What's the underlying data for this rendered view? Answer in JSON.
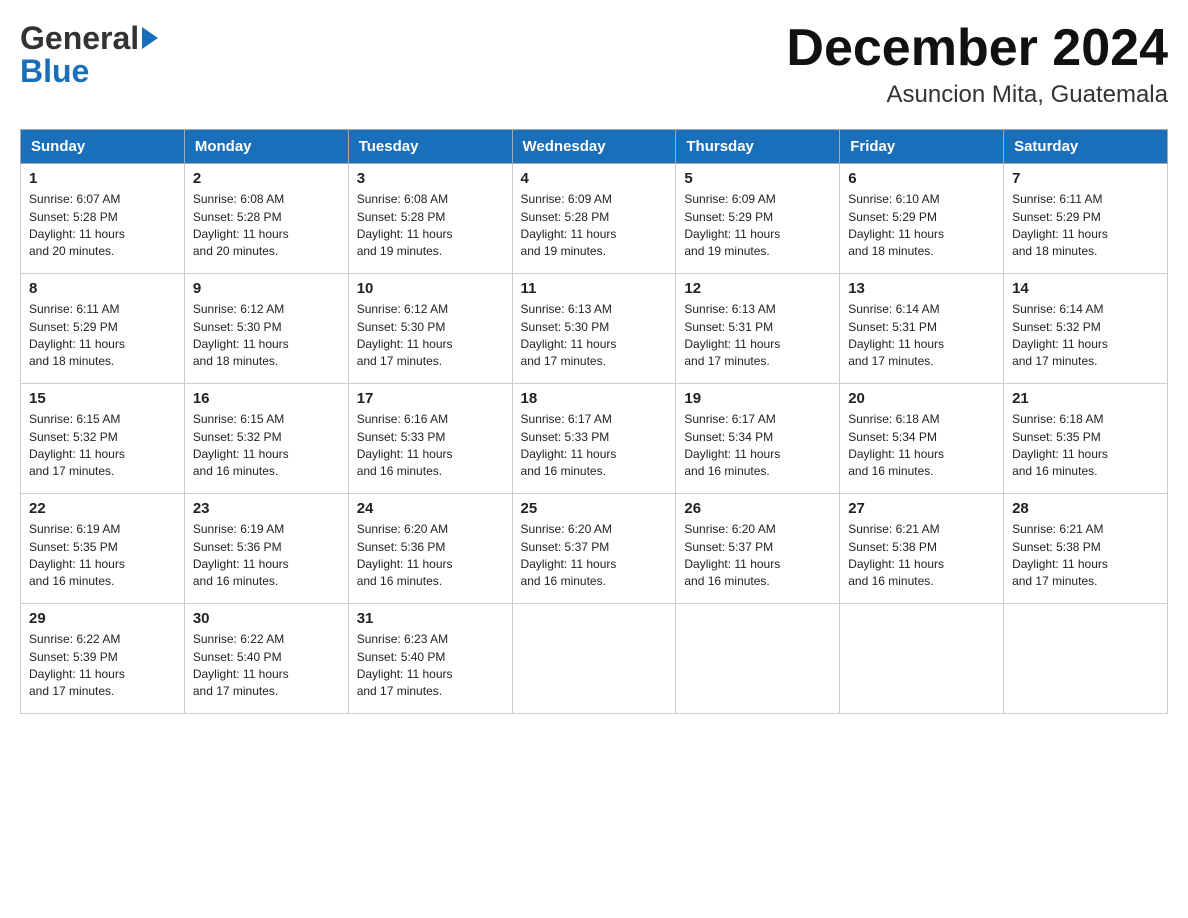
{
  "header": {
    "logo_general": "General",
    "logo_blue": "Blue",
    "month_title": "December 2024",
    "location": "Asuncion Mita, Guatemala"
  },
  "weekdays": [
    "Sunday",
    "Monday",
    "Tuesday",
    "Wednesday",
    "Thursday",
    "Friday",
    "Saturday"
  ],
  "weeks": [
    [
      {
        "day": "1",
        "sunrise": "6:07 AM",
        "sunset": "5:28 PM",
        "daylight": "11 hours and 20 minutes."
      },
      {
        "day": "2",
        "sunrise": "6:08 AM",
        "sunset": "5:28 PM",
        "daylight": "11 hours and 20 minutes."
      },
      {
        "day": "3",
        "sunrise": "6:08 AM",
        "sunset": "5:28 PM",
        "daylight": "11 hours and 19 minutes."
      },
      {
        "day": "4",
        "sunrise": "6:09 AM",
        "sunset": "5:28 PM",
        "daylight": "11 hours and 19 minutes."
      },
      {
        "day": "5",
        "sunrise": "6:09 AM",
        "sunset": "5:29 PM",
        "daylight": "11 hours and 19 minutes."
      },
      {
        "day": "6",
        "sunrise": "6:10 AM",
        "sunset": "5:29 PM",
        "daylight": "11 hours and 18 minutes."
      },
      {
        "day": "7",
        "sunrise": "6:11 AM",
        "sunset": "5:29 PM",
        "daylight": "11 hours and 18 minutes."
      }
    ],
    [
      {
        "day": "8",
        "sunrise": "6:11 AM",
        "sunset": "5:29 PM",
        "daylight": "11 hours and 18 minutes."
      },
      {
        "day": "9",
        "sunrise": "6:12 AM",
        "sunset": "5:30 PM",
        "daylight": "11 hours and 18 minutes."
      },
      {
        "day": "10",
        "sunrise": "6:12 AM",
        "sunset": "5:30 PM",
        "daylight": "11 hours and 17 minutes."
      },
      {
        "day": "11",
        "sunrise": "6:13 AM",
        "sunset": "5:30 PM",
        "daylight": "11 hours and 17 minutes."
      },
      {
        "day": "12",
        "sunrise": "6:13 AM",
        "sunset": "5:31 PM",
        "daylight": "11 hours and 17 minutes."
      },
      {
        "day": "13",
        "sunrise": "6:14 AM",
        "sunset": "5:31 PM",
        "daylight": "11 hours and 17 minutes."
      },
      {
        "day": "14",
        "sunrise": "6:14 AM",
        "sunset": "5:32 PM",
        "daylight": "11 hours and 17 minutes."
      }
    ],
    [
      {
        "day": "15",
        "sunrise": "6:15 AM",
        "sunset": "5:32 PM",
        "daylight": "11 hours and 17 minutes."
      },
      {
        "day": "16",
        "sunrise": "6:15 AM",
        "sunset": "5:32 PM",
        "daylight": "11 hours and 16 minutes."
      },
      {
        "day": "17",
        "sunrise": "6:16 AM",
        "sunset": "5:33 PM",
        "daylight": "11 hours and 16 minutes."
      },
      {
        "day": "18",
        "sunrise": "6:17 AM",
        "sunset": "5:33 PM",
        "daylight": "11 hours and 16 minutes."
      },
      {
        "day": "19",
        "sunrise": "6:17 AM",
        "sunset": "5:34 PM",
        "daylight": "11 hours and 16 minutes."
      },
      {
        "day": "20",
        "sunrise": "6:18 AM",
        "sunset": "5:34 PM",
        "daylight": "11 hours and 16 minutes."
      },
      {
        "day": "21",
        "sunrise": "6:18 AM",
        "sunset": "5:35 PM",
        "daylight": "11 hours and 16 minutes."
      }
    ],
    [
      {
        "day": "22",
        "sunrise": "6:19 AM",
        "sunset": "5:35 PM",
        "daylight": "11 hours and 16 minutes."
      },
      {
        "day": "23",
        "sunrise": "6:19 AM",
        "sunset": "5:36 PM",
        "daylight": "11 hours and 16 minutes."
      },
      {
        "day": "24",
        "sunrise": "6:20 AM",
        "sunset": "5:36 PM",
        "daylight": "11 hours and 16 minutes."
      },
      {
        "day": "25",
        "sunrise": "6:20 AM",
        "sunset": "5:37 PM",
        "daylight": "11 hours and 16 minutes."
      },
      {
        "day": "26",
        "sunrise": "6:20 AM",
        "sunset": "5:37 PM",
        "daylight": "11 hours and 16 minutes."
      },
      {
        "day": "27",
        "sunrise": "6:21 AM",
        "sunset": "5:38 PM",
        "daylight": "11 hours and 16 minutes."
      },
      {
        "day": "28",
        "sunrise": "6:21 AM",
        "sunset": "5:38 PM",
        "daylight": "11 hours and 17 minutes."
      }
    ],
    [
      {
        "day": "29",
        "sunrise": "6:22 AM",
        "sunset": "5:39 PM",
        "daylight": "11 hours and 17 minutes."
      },
      {
        "day": "30",
        "sunrise": "6:22 AM",
        "sunset": "5:40 PM",
        "daylight": "11 hours and 17 minutes."
      },
      {
        "day": "31",
        "sunrise": "6:23 AM",
        "sunset": "5:40 PM",
        "daylight": "11 hours and 17 minutes."
      },
      null,
      null,
      null,
      null
    ]
  ],
  "labels": {
    "sunrise": "Sunrise:",
    "sunset": "Sunset:",
    "daylight": "Daylight:"
  }
}
